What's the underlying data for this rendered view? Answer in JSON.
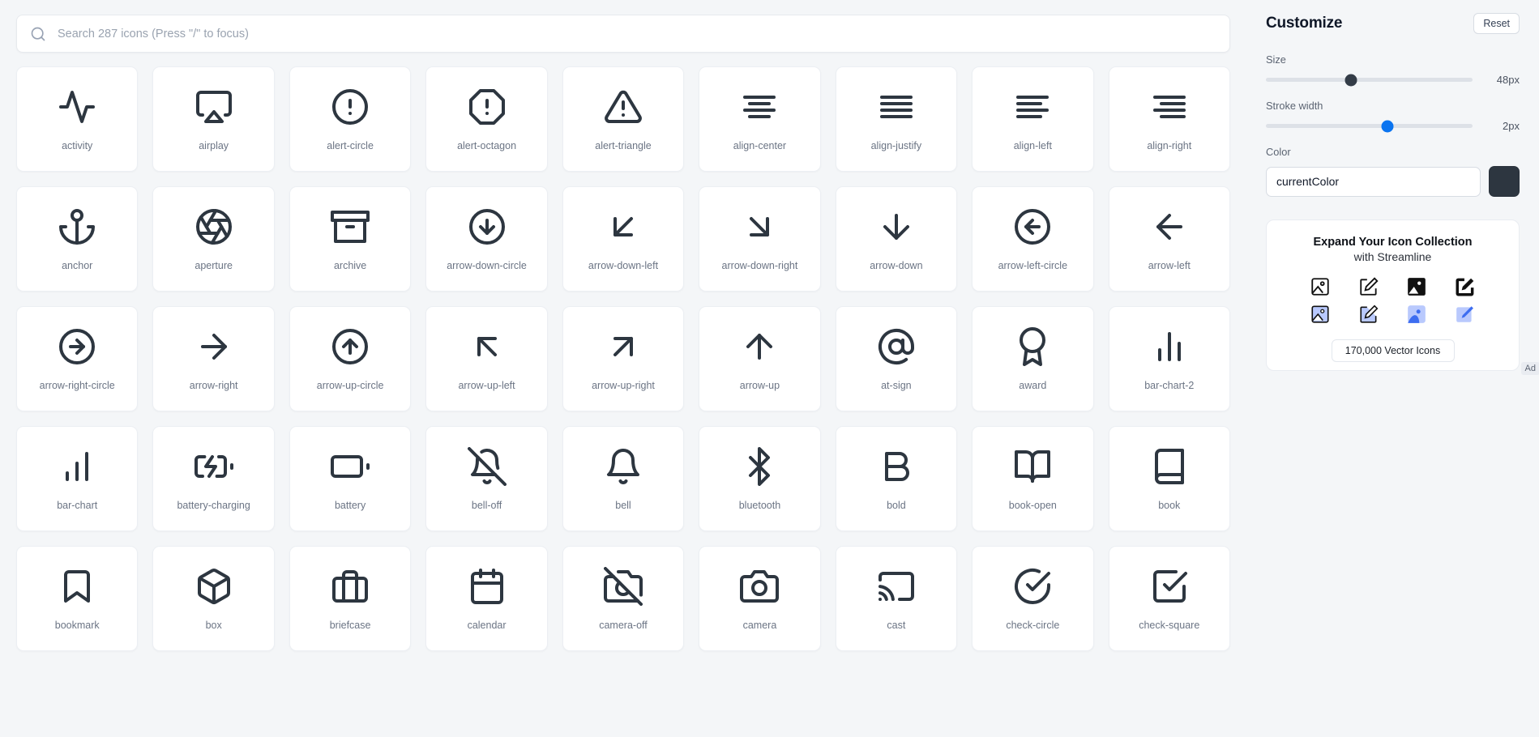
{
  "search": {
    "placeholder": "Search 287 icons (Press \"/\" to focus)",
    "value": "",
    "icon": "search-icon",
    "icon_count": 287
  },
  "sidebar": {
    "title": "Customize",
    "reset_label": "Reset",
    "controls": {
      "size": {
        "label": "Size",
        "value": "48px",
        "number": 48,
        "percent": 41
      },
      "stroke": {
        "label": "Stroke width",
        "value": "2px",
        "number": 2,
        "percent": 59
      },
      "color": {
        "label": "Color",
        "value": "currentColor",
        "swatch": "#2d3640"
      }
    },
    "ad": {
      "title": "Expand Your Icon Collection",
      "subtitle": "with Streamline",
      "cta": "170,000 Vector Icons",
      "tag": "Ad",
      "accent": "#8ba4fb",
      "accent_strong": "#3d6df0"
    }
  },
  "colors": {
    "page_bg": "#f4f6f8",
    "card_bg": "#ffffff",
    "icon_color": "#2d3640",
    "label_color": "#6b7484",
    "slider_blue": "#0a74f0",
    "slider_dark": "#333c47"
  },
  "grid": {
    "icons": [
      {
        "name": "activity",
        "glyph": "activity"
      },
      {
        "name": "airplay",
        "glyph": "airplay"
      },
      {
        "name": "alert-circle",
        "glyph": "alert-circle"
      },
      {
        "name": "alert-octagon",
        "glyph": "alert-octagon"
      },
      {
        "name": "alert-triangle",
        "glyph": "alert-triangle"
      },
      {
        "name": "align-center",
        "glyph": "align-center"
      },
      {
        "name": "align-justify",
        "glyph": "align-justify"
      },
      {
        "name": "align-left",
        "glyph": "align-left"
      },
      {
        "name": "align-right",
        "glyph": "align-right"
      },
      {
        "name": "anchor",
        "glyph": "anchor"
      },
      {
        "name": "aperture",
        "glyph": "aperture"
      },
      {
        "name": "archive",
        "glyph": "archive"
      },
      {
        "name": "arrow-down-circle",
        "glyph": "arrow-down-circle"
      },
      {
        "name": "arrow-down-left",
        "glyph": "arrow-down-left"
      },
      {
        "name": "arrow-down-right",
        "glyph": "arrow-down-right"
      },
      {
        "name": "arrow-down",
        "glyph": "arrow-down"
      },
      {
        "name": "arrow-left-circle",
        "glyph": "arrow-left-circle"
      },
      {
        "name": "arrow-left",
        "glyph": "arrow-left"
      },
      {
        "name": "arrow-right-circle",
        "glyph": "arrow-right-circle"
      },
      {
        "name": "arrow-right",
        "glyph": "arrow-right"
      },
      {
        "name": "arrow-up-circle",
        "glyph": "arrow-up-circle"
      },
      {
        "name": "arrow-up-left",
        "glyph": "arrow-up-left"
      },
      {
        "name": "arrow-up-right",
        "glyph": "arrow-up-right"
      },
      {
        "name": "arrow-up",
        "glyph": "arrow-up"
      },
      {
        "name": "at-sign",
        "glyph": "at-sign"
      },
      {
        "name": "award",
        "glyph": "award"
      },
      {
        "name": "bar-chart-2",
        "glyph": "bar-chart-2"
      },
      {
        "name": "bar-chart",
        "glyph": "bar-chart"
      },
      {
        "name": "battery-charging",
        "glyph": "battery-charging"
      },
      {
        "name": "battery",
        "glyph": "battery"
      },
      {
        "name": "bell-off",
        "glyph": "bell-off"
      },
      {
        "name": "bell",
        "glyph": "bell"
      },
      {
        "name": "bluetooth",
        "glyph": "bluetooth"
      },
      {
        "name": "bold",
        "glyph": "bold"
      },
      {
        "name": "book-open",
        "glyph": "book-open"
      },
      {
        "name": "book",
        "glyph": "book"
      },
      {
        "name": "bookmark",
        "glyph": "bookmark"
      },
      {
        "name": "box",
        "glyph": "box"
      },
      {
        "name": "briefcase",
        "glyph": "briefcase"
      },
      {
        "name": "calendar",
        "glyph": "calendar"
      },
      {
        "name": "camera-off",
        "glyph": "camera-off"
      },
      {
        "name": "camera",
        "glyph": "camera"
      },
      {
        "name": "cast",
        "glyph": "cast"
      },
      {
        "name": "check-circle",
        "glyph": "check-circle"
      },
      {
        "name": "check-square",
        "glyph": "check-square"
      }
    ]
  }
}
